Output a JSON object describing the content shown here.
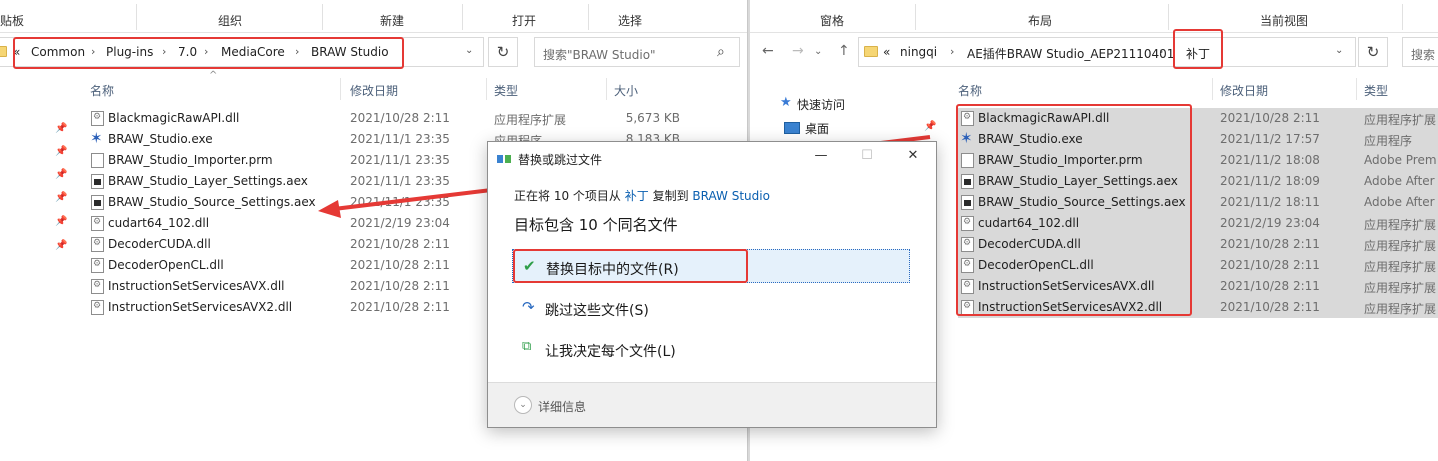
{
  "left_window": {
    "ribbon": [
      "剪贴板",
      "组织",
      "新建",
      "打开",
      "选择"
    ],
    "breadcrumb": [
      "«",
      "Common",
      "Plug-ins",
      "7.0",
      "MediaCore",
      "BRAW Studio"
    ],
    "search_placeholder": "搜索\"BRAW Studio\"",
    "columns": {
      "name": "名称",
      "date": "修改日期",
      "type": "类型",
      "size": "大小"
    },
    "files": [
      {
        "name": "BlackmagicRawAPI.dll",
        "date": "2021/10/28 2:11",
        "type": "应用程序扩展",
        "size": "5,673 KB",
        "icon": "dll"
      },
      {
        "name": "BRAW_Studio.exe",
        "date": "2021/11/1 23:35",
        "type": "应用程序",
        "size": "8,183 KB",
        "icon": "exe"
      },
      {
        "name": "BRAW_Studio_Importer.prm",
        "date": "2021/11/1 23:35",
        "type": "",
        "size": "",
        "icon": "prm"
      },
      {
        "name": "BRAW_Studio_Layer_Settings.aex",
        "date": "2021/11/1 23:35",
        "type": "",
        "size": "",
        "icon": "aex"
      },
      {
        "name": "BRAW_Studio_Source_Settings.aex",
        "date": "2021/11/1 23:35",
        "type": "",
        "size": "",
        "icon": "aex"
      },
      {
        "name": "cudart64_102.dll",
        "date": "2021/2/19 23:04",
        "type": "",
        "size": "",
        "icon": "dll"
      },
      {
        "name": "DecoderCUDA.dll",
        "date": "2021/10/28 2:11",
        "type": "",
        "size": "",
        "icon": "dll"
      },
      {
        "name": "DecoderOpenCL.dll",
        "date": "2021/10/28 2:11",
        "type": "",
        "size": "",
        "icon": "dll"
      },
      {
        "name": "InstructionSetServicesAVX.dll",
        "date": "2021/10/28 2:11",
        "type": "",
        "size": "",
        "icon": "dll"
      },
      {
        "name": "InstructionSetServicesAVX2.dll",
        "date": "2021/10/28 2:11",
        "type": "",
        "size": "",
        "icon": "dll"
      }
    ]
  },
  "right_window": {
    "ribbon": [
      "窗格",
      "布局",
      "当前视图"
    ],
    "breadcrumb": [
      "«",
      "ningqi",
      "AE插件BRAW Studio_AEP21110401",
      "补丁"
    ],
    "search_placeholder": "搜索",
    "columns": {
      "name": "名称",
      "date": "修改日期",
      "type": "类型"
    },
    "nav": {
      "quick_access": "快速访问",
      "desktop": "桌面"
    },
    "files": [
      {
        "name": "BlackmagicRawAPI.dll",
        "date": "2021/10/28 2:11",
        "type": "应用程序扩展",
        "icon": "dll"
      },
      {
        "name": "BRAW_Studio.exe",
        "date": "2021/11/2 17:57",
        "type": "应用程序",
        "icon": "exe"
      },
      {
        "name": "BRAW_Studio_Importer.prm",
        "date": "2021/11/2 18:08",
        "type": "Adobe Prem",
        "icon": "prm"
      },
      {
        "name": "BRAW_Studio_Layer_Settings.aex",
        "date": "2021/11/2 18:09",
        "type": "Adobe After",
        "icon": "aex"
      },
      {
        "name": "BRAW_Studio_Source_Settings.aex",
        "date": "2021/11/2 18:11",
        "type": "Adobe After",
        "icon": "aex"
      },
      {
        "name": "cudart64_102.dll",
        "date": "2021/2/19 23:04",
        "type": "应用程序扩展",
        "icon": "dll"
      },
      {
        "name": "DecoderCUDA.dll",
        "date": "2021/10/28 2:11",
        "type": "应用程序扩展",
        "icon": "dll"
      },
      {
        "name": "DecoderOpenCL.dll",
        "date": "2021/10/28 2:11",
        "type": "应用程序扩展",
        "icon": "dll"
      },
      {
        "name": "InstructionSetServicesAVX.dll",
        "date": "2021/10/28 2:11",
        "type": "应用程序扩展",
        "icon": "dll"
      },
      {
        "name": "InstructionSetServicesAVX2.dll",
        "date": "2021/10/28 2:11",
        "type": "应用程序扩展",
        "icon": "dll"
      }
    ]
  },
  "dialog": {
    "title": "替换或跳过文件",
    "msg_prefix": "正在将 10 个项目从",
    "msg_source": "补丁",
    "msg_mid": "复制到",
    "msg_dest": "BRAW Studio",
    "heading": "目标包含 10 个同名文件",
    "options": [
      {
        "label": "替换目标中的文件(R)",
        "icon": "check-icon"
      },
      {
        "label": "跳过这些文件(S)",
        "icon": "skip-arrow-icon"
      },
      {
        "label": "让我决定每个文件(L)",
        "icon": "decide-files-icon"
      }
    ],
    "details": "详细信息"
  },
  "colors": {
    "annotation_red": "#e53935",
    "link_blue": "#0a5fb0",
    "highlight": "#e5f1fb",
    "selected_row": "#d9d9d9"
  }
}
